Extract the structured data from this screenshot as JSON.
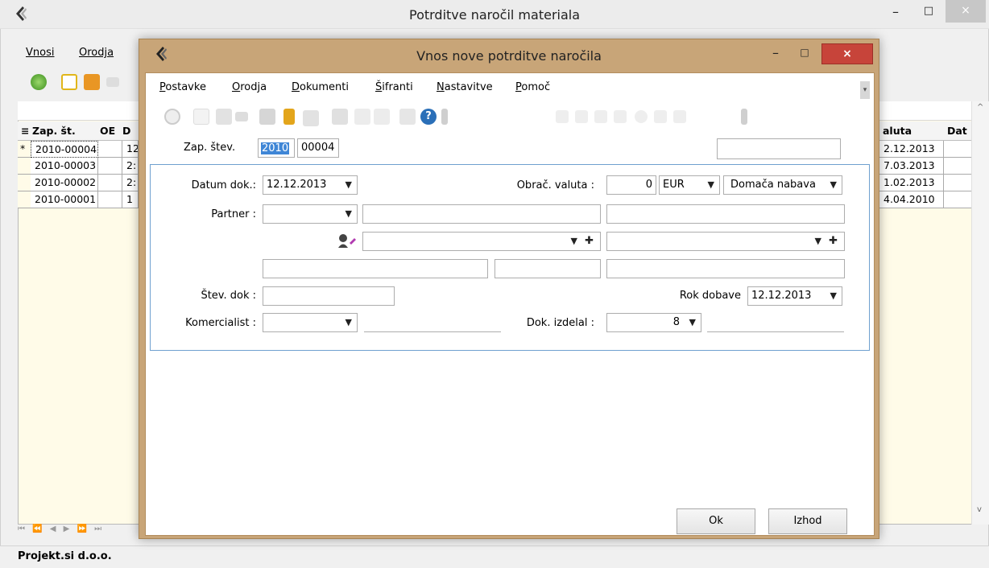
{
  "main_window": {
    "title": "Potrditve naročil materiala",
    "controls": {
      "minimize": "–",
      "maximize": "□",
      "close": "×"
    },
    "menu": [
      {
        "label": "Vnosi"
      },
      {
        "label": "Orodja"
      }
    ],
    "grid": {
      "headers": {
        "marker": "≡",
        "zap_st": "Zap. št.",
        "oe": "OE",
        "d": "D",
        "valuta": "aluta",
        "dat": "Dat"
      },
      "rows": [
        {
          "marker": "*",
          "zap_st": "2010-00004",
          "oe": "",
          "d": "12",
          "valuta": "2.12.2013"
        },
        {
          "marker": "",
          "zap_st": "2010-00003",
          "oe": "",
          "d": "2:",
          "valuta": "7.03.2013"
        },
        {
          "marker": "",
          "zap_st": "2010-00002",
          "oe": "",
          "d": "2:",
          "valuta": "1.02.2013"
        },
        {
          "marker": "",
          "zap_st": "2010-00001",
          "oe": "",
          "d": "1",
          "valuta": "4.04.2010"
        }
      ],
      "nav": "⏮ ⏪ ◀ ▶ ⏩ ⏭"
    },
    "status": {
      "company": "Projekt.si d.o.o."
    }
  },
  "dialog": {
    "title": "Vnos nove potrditve naročila",
    "controls": {
      "minimize": "–",
      "maximize": "□",
      "close": "×"
    },
    "menu": [
      {
        "pre": "",
        "ul": "P",
        "post": "ostavke"
      },
      {
        "pre": "",
        "ul": "O",
        "post": "rodja"
      },
      {
        "pre": "",
        "ul": "D",
        "post": "okumenti"
      },
      {
        "pre": "",
        "ul": "Š",
        "post": "ifranti"
      },
      {
        "pre": "",
        "ul": "N",
        "post": "astavitve"
      },
      {
        "pre": "",
        "ul": "P",
        "post": "omoč"
      }
    ],
    "header": {
      "zap_label": "Zap. štev.",
      "zap_year": "2010",
      "zap_number": "00004",
      "right_field": ""
    },
    "form": {
      "datum_label": "Datum dok.:",
      "datum_value": "12.12.2013",
      "obrac_label": "Obrač. valuta :",
      "obrac_value": "0",
      "currency": "EUR",
      "nabava": "Domača nabava",
      "partner_label": "Partner :",
      "partner_value": "",
      "stev_dok_label": "Štev. dok :",
      "stev_dok_value": "",
      "rok_label": "Rok dobave",
      "rok_value": "12.12.2013",
      "komercialist_label": "Komercialist :",
      "komercialist_value": "",
      "izdelal_label": "Dok. izdelal :",
      "izdelal_value": "8"
    },
    "buttons": {
      "ok": "Ok",
      "izhod": "Izhod"
    }
  },
  "colors": {
    "dialog_frame": "#c8a578",
    "close_red": "#c7443a",
    "group_border": "#6fa0cf",
    "grid_bg": "#fffbe8"
  }
}
